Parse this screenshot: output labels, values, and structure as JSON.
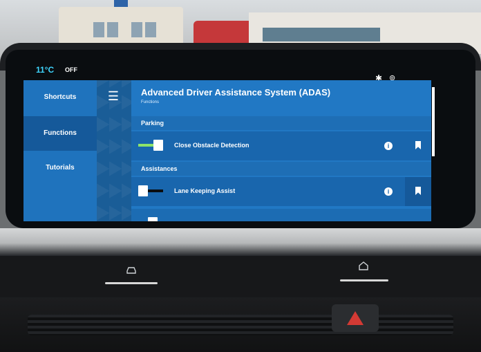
{
  "status": {
    "temperature": "11°C",
    "ac_state": "OFF",
    "icons": [
      "bluetooth-icon",
      "location-icon"
    ]
  },
  "sidebar": {
    "items": [
      {
        "label": "Shortcuts",
        "active": false
      },
      {
        "label": "Functions",
        "active": true
      },
      {
        "label": "Tutorials",
        "active": false
      }
    ]
  },
  "header": {
    "title": "Advanced Driver Assistance System (ADAS)",
    "subtitle": "Functions"
  },
  "sections": [
    {
      "label": "Parking",
      "rows": [
        {
          "label": "Close Obstacle Detection",
          "enabled": true,
          "favorite": false
        }
      ]
    },
    {
      "label": "Assistances",
      "rows": [
        {
          "label": "Lane Keeping Assist",
          "enabled": false,
          "favorite": true
        }
      ]
    }
  ],
  "colors": {
    "accent": "#2178c4",
    "toggle_on": "#8de36a",
    "temperature": "#3fd6ff"
  }
}
